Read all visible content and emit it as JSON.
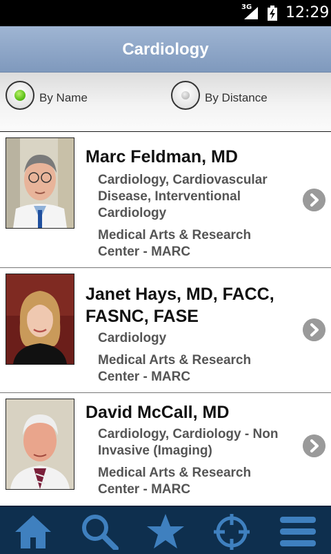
{
  "status_bar": {
    "network": "3G",
    "time": "12:29"
  },
  "header": {
    "title": "Cardiology"
  },
  "sort": {
    "options": [
      {
        "label": "By Name",
        "selected": true
      },
      {
        "label": "By Distance",
        "selected": false
      }
    ]
  },
  "doctors": [
    {
      "name": "Marc Feldman, MD",
      "specialty": "Cardiology, Cardiovascular Disease, Interventional Cardiology",
      "location": "Medical Arts & Research Center - MARC"
    },
    {
      "name": "Janet Hays, MD, FACC, FASNC, FASE",
      "specialty": "Cardiology",
      "location": "Medical Arts & Research Center - MARC"
    },
    {
      "name": "David McCall, MD",
      "specialty": "Cardiology, Cardiology - Non Invasive (Imaging)",
      "location": "Medical Arts & Research Center - MARC"
    }
  ],
  "tabs": [
    {
      "icon": "home-icon"
    },
    {
      "icon": "search-icon"
    },
    {
      "icon": "star-icon"
    },
    {
      "icon": "locate-icon"
    },
    {
      "icon": "menu-icon"
    }
  ],
  "colors": {
    "tabbar": "#0e2f4e",
    "tab_icon": "#3f80bf",
    "title_bar": "#8ba3c6",
    "radio_selected": "#5fc21a"
  }
}
